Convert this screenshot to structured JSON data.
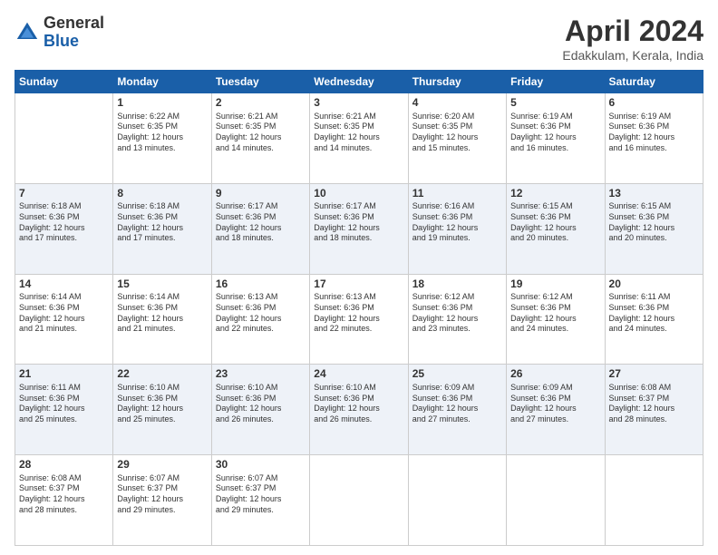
{
  "logo": {
    "general": "General",
    "blue": "Blue"
  },
  "title": "April 2024",
  "location": "Edakkulam, Kerala, India",
  "days_of_week": [
    "Sunday",
    "Monday",
    "Tuesday",
    "Wednesday",
    "Thursday",
    "Friday",
    "Saturday"
  ],
  "weeks": [
    [
      {
        "day": "",
        "info": ""
      },
      {
        "day": "1",
        "info": "Sunrise: 6:22 AM\nSunset: 6:35 PM\nDaylight: 12 hours\nand 13 minutes."
      },
      {
        "day": "2",
        "info": "Sunrise: 6:21 AM\nSunset: 6:35 PM\nDaylight: 12 hours\nand 14 minutes."
      },
      {
        "day": "3",
        "info": "Sunrise: 6:21 AM\nSunset: 6:35 PM\nDaylight: 12 hours\nand 14 minutes."
      },
      {
        "day": "4",
        "info": "Sunrise: 6:20 AM\nSunset: 6:35 PM\nDaylight: 12 hours\nand 15 minutes."
      },
      {
        "day": "5",
        "info": "Sunrise: 6:19 AM\nSunset: 6:36 PM\nDaylight: 12 hours\nand 16 minutes."
      },
      {
        "day": "6",
        "info": "Sunrise: 6:19 AM\nSunset: 6:36 PM\nDaylight: 12 hours\nand 16 minutes."
      }
    ],
    [
      {
        "day": "7",
        "info": "Sunrise: 6:18 AM\nSunset: 6:36 PM\nDaylight: 12 hours\nand 17 minutes."
      },
      {
        "day": "8",
        "info": "Sunrise: 6:18 AM\nSunset: 6:36 PM\nDaylight: 12 hours\nand 17 minutes."
      },
      {
        "day": "9",
        "info": "Sunrise: 6:17 AM\nSunset: 6:36 PM\nDaylight: 12 hours\nand 18 minutes."
      },
      {
        "day": "10",
        "info": "Sunrise: 6:17 AM\nSunset: 6:36 PM\nDaylight: 12 hours\nand 18 minutes."
      },
      {
        "day": "11",
        "info": "Sunrise: 6:16 AM\nSunset: 6:36 PM\nDaylight: 12 hours\nand 19 minutes."
      },
      {
        "day": "12",
        "info": "Sunrise: 6:15 AM\nSunset: 6:36 PM\nDaylight: 12 hours\nand 20 minutes."
      },
      {
        "day": "13",
        "info": "Sunrise: 6:15 AM\nSunset: 6:36 PM\nDaylight: 12 hours\nand 20 minutes."
      }
    ],
    [
      {
        "day": "14",
        "info": "Sunrise: 6:14 AM\nSunset: 6:36 PM\nDaylight: 12 hours\nand 21 minutes."
      },
      {
        "day": "15",
        "info": "Sunrise: 6:14 AM\nSunset: 6:36 PM\nDaylight: 12 hours\nand 21 minutes."
      },
      {
        "day": "16",
        "info": "Sunrise: 6:13 AM\nSunset: 6:36 PM\nDaylight: 12 hours\nand 22 minutes."
      },
      {
        "day": "17",
        "info": "Sunrise: 6:13 AM\nSunset: 6:36 PM\nDaylight: 12 hours\nand 22 minutes."
      },
      {
        "day": "18",
        "info": "Sunrise: 6:12 AM\nSunset: 6:36 PM\nDaylight: 12 hours\nand 23 minutes."
      },
      {
        "day": "19",
        "info": "Sunrise: 6:12 AM\nSunset: 6:36 PM\nDaylight: 12 hours\nand 24 minutes."
      },
      {
        "day": "20",
        "info": "Sunrise: 6:11 AM\nSunset: 6:36 PM\nDaylight: 12 hours\nand 24 minutes."
      }
    ],
    [
      {
        "day": "21",
        "info": "Sunrise: 6:11 AM\nSunset: 6:36 PM\nDaylight: 12 hours\nand 25 minutes."
      },
      {
        "day": "22",
        "info": "Sunrise: 6:10 AM\nSunset: 6:36 PM\nDaylight: 12 hours\nand 25 minutes."
      },
      {
        "day": "23",
        "info": "Sunrise: 6:10 AM\nSunset: 6:36 PM\nDaylight: 12 hours\nand 26 minutes."
      },
      {
        "day": "24",
        "info": "Sunrise: 6:10 AM\nSunset: 6:36 PM\nDaylight: 12 hours\nand 26 minutes."
      },
      {
        "day": "25",
        "info": "Sunrise: 6:09 AM\nSunset: 6:36 PM\nDaylight: 12 hours\nand 27 minutes."
      },
      {
        "day": "26",
        "info": "Sunrise: 6:09 AM\nSunset: 6:36 PM\nDaylight: 12 hours\nand 27 minutes."
      },
      {
        "day": "27",
        "info": "Sunrise: 6:08 AM\nSunset: 6:37 PM\nDaylight: 12 hours\nand 28 minutes."
      }
    ],
    [
      {
        "day": "28",
        "info": "Sunrise: 6:08 AM\nSunset: 6:37 PM\nDaylight: 12 hours\nand 28 minutes."
      },
      {
        "day": "29",
        "info": "Sunrise: 6:07 AM\nSunset: 6:37 PM\nDaylight: 12 hours\nand 29 minutes."
      },
      {
        "day": "30",
        "info": "Sunrise: 6:07 AM\nSunset: 6:37 PM\nDaylight: 12 hours\nand 29 minutes."
      },
      {
        "day": "",
        "info": ""
      },
      {
        "day": "",
        "info": ""
      },
      {
        "day": "",
        "info": ""
      },
      {
        "day": "",
        "info": ""
      }
    ]
  ]
}
